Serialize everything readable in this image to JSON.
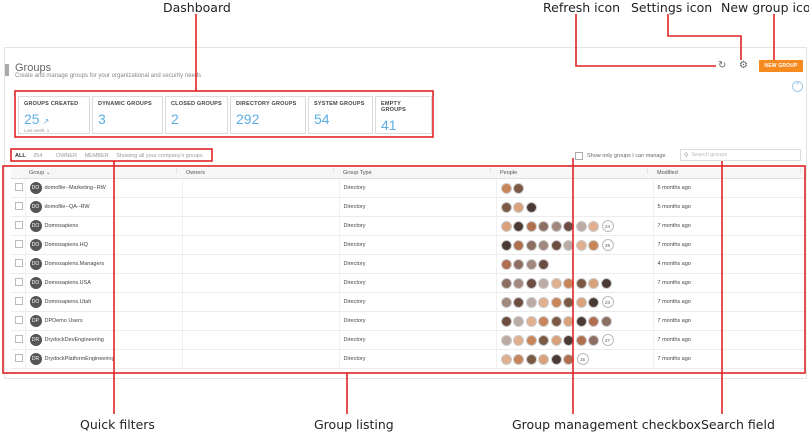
{
  "callouts": {
    "dashboard": "Dashboard",
    "refresh": "Refresh icon",
    "settings": "Settings icon",
    "new_group": "New group icon",
    "quick_filters": "Quick filters",
    "group_listing": "Group listing",
    "group_mgmt": "Group management checkbox",
    "search_field": "Search field"
  },
  "header": {
    "title": "Groups",
    "subtitle": "Create and manage groups for your organizational and security needs",
    "new_group_label": "NEW GROUP",
    "refresh_icon": "refresh-icon",
    "settings_icon": "gear-icon",
    "collapse_icon": "chevron-up-icon"
  },
  "dashboard": [
    {
      "label": "GROUPS CREATED",
      "value": "25",
      "sub": "Last week: 1"
    },
    {
      "label": "DYNAMIC GROUPS",
      "value": "3"
    },
    {
      "label": "CLOSED GROUPS",
      "value": "2"
    },
    {
      "label": "DIRECTORY GROUPS",
      "value": "292"
    },
    {
      "label": "SYSTEM GROUPS",
      "value": "54"
    },
    {
      "label": "EMPTY GROUPS",
      "value": "41"
    }
  ],
  "filters": {
    "all": "ALL",
    "all_count": "254",
    "owner": "OWNER",
    "member": "MEMBER",
    "scope": "Showing all your company's groups"
  },
  "manage_checkbox_label": "Show only groups I can manage",
  "search_placeholder": "Search groups",
  "table": {
    "columns": [
      "Group",
      "Owners",
      "Group Type",
      "People",
      "Modified"
    ],
    "rows": [
      {
        "initials": "DO",
        "name": "domofile--Marketing--RW",
        "owners": "",
        "type": "Directory",
        "avatars": 2,
        "more": "",
        "modified": "6 months ago"
      },
      {
        "initials": "DO",
        "name": "domofile--QA--RW",
        "owners": "",
        "type": "Directory",
        "avatars": 3,
        "more": "",
        "modified": "5 months ago"
      },
      {
        "initials": "DO",
        "name": "Domosapiens",
        "owners": "",
        "type": "Directory",
        "avatars": 8,
        "more": "24",
        "modified": "7 months ago"
      },
      {
        "initials": "DO",
        "name": "Domosapiens.HQ",
        "owners": "",
        "type": "Directory",
        "avatars": 8,
        "more": "25",
        "modified": "7 months ago"
      },
      {
        "initials": "DO",
        "name": "Domosapiens.Managers",
        "owners": "",
        "type": "Directory",
        "avatars": 4,
        "more": "",
        "modified": "4 months ago"
      },
      {
        "initials": "DO",
        "name": "Domosapiens.USA",
        "owners": "",
        "type": "Directory",
        "avatars": 9,
        "more": "",
        "modified": "7 months ago"
      },
      {
        "initials": "DO",
        "name": "Domosapiens.Utah",
        "owners": "",
        "type": "Directory",
        "avatars": 8,
        "more": "23",
        "modified": "7 months ago"
      },
      {
        "initials": "DP",
        "name": "DPDemo Users",
        "owners": "",
        "type": "Directory",
        "avatars": 9,
        "more": "",
        "modified": "7 months ago"
      },
      {
        "initials": "DR",
        "name": "DrydockDevEngineering",
        "owners": "",
        "type": "Directory",
        "avatars": 8,
        "more": "27",
        "modified": "7 months ago"
      },
      {
        "initials": "DR",
        "name": "DrydockPlatformEngineering",
        "owners": "",
        "type": "Directory",
        "avatars": 6,
        "more": "15",
        "modified": "7 months ago"
      }
    ]
  },
  "colors": {
    "accent": "#f58a1f",
    "stat_value": "#5eaee4",
    "callout_line": "#e02424"
  }
}
